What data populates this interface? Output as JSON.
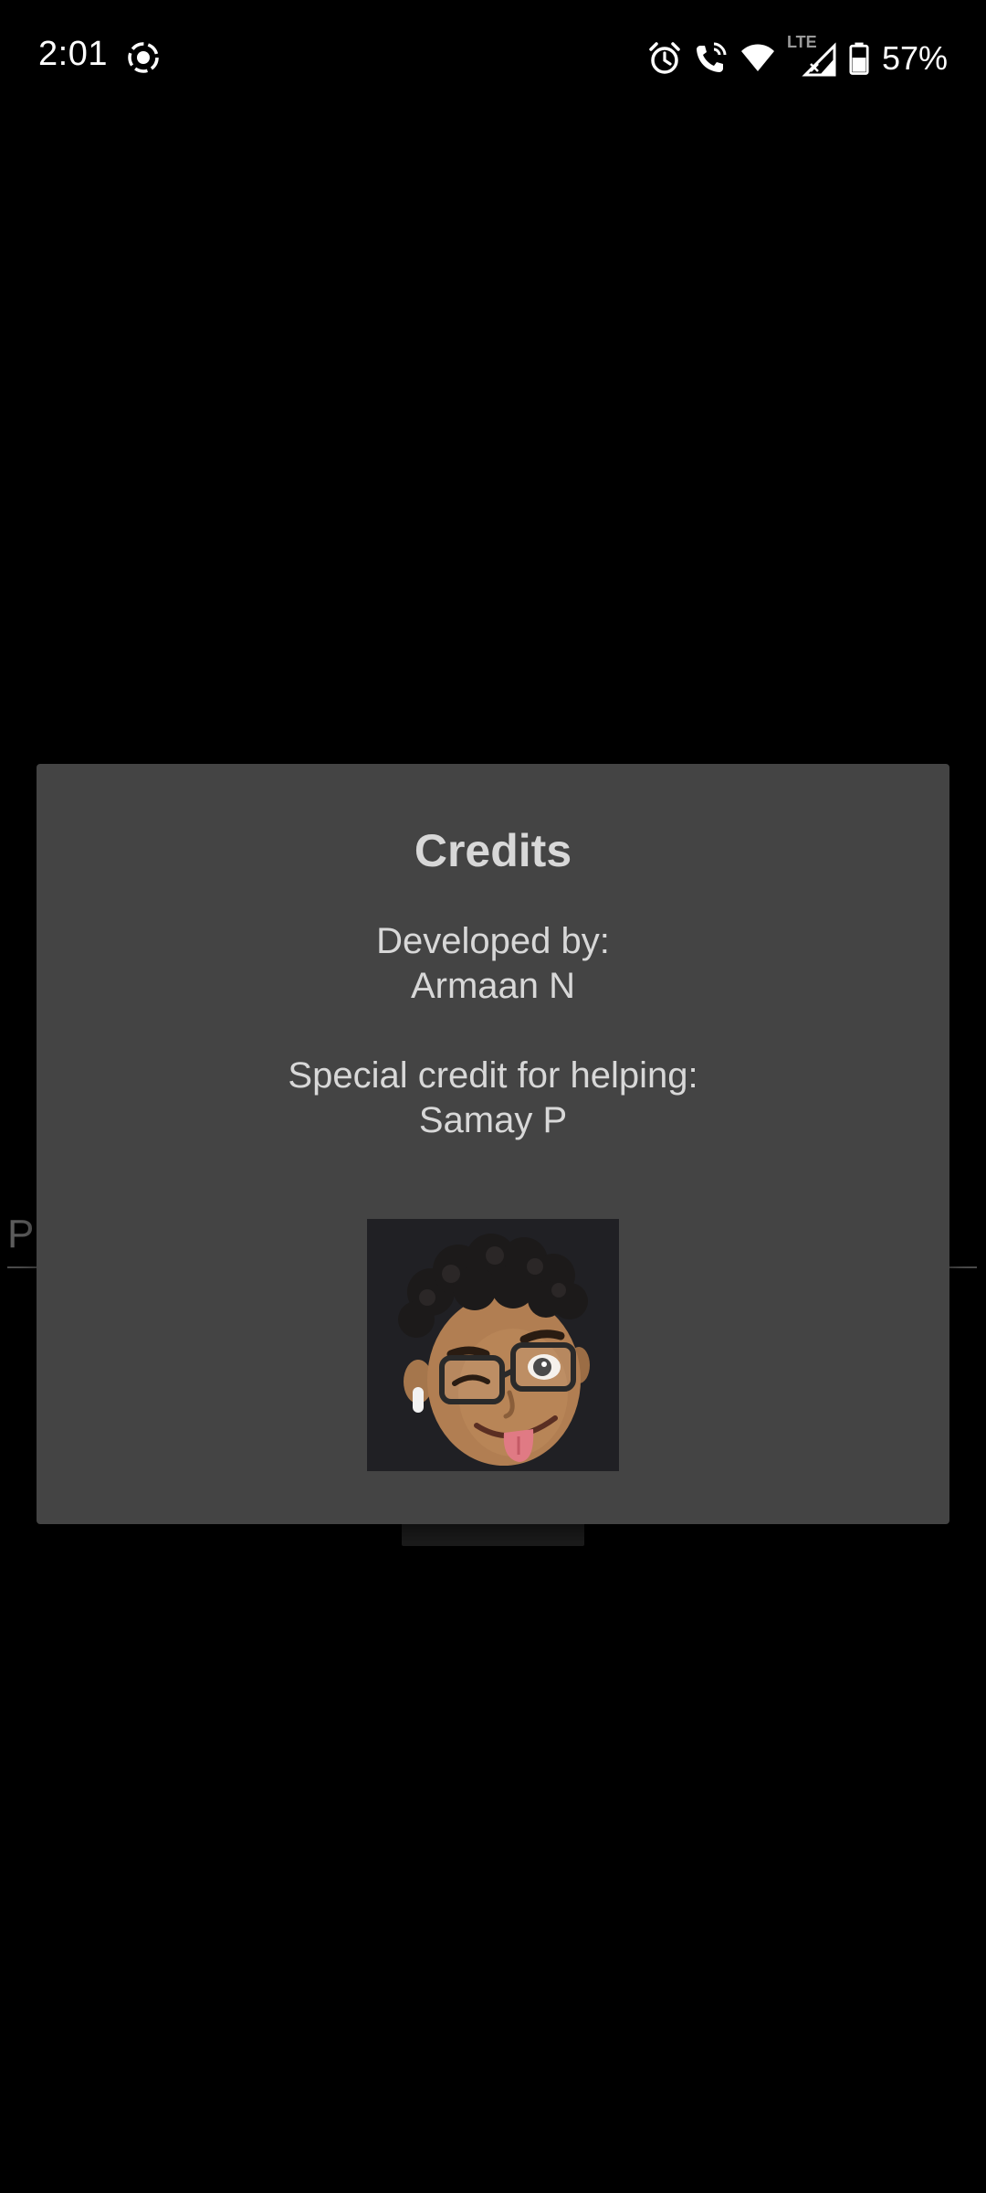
{
  "status_bar": {
    "time": "2:01",
    "network_label": "LTE",
    "battery_percent": "57%",
    "icons": [
      "screen-record-icon",
      "alarm-icon",
      "wifi-calling-icon",
      "wifi-icon",
      "cellular-signal-icon",
      "battery-icon"
    ]
  },
  "background": {
    "field_text": "P"
  },
  "dialog": {
    "title": "Credits",
    "lines": {
      "developed_label": "Developed by:",
      "developer_name": "Armaan N",
      "special_label": "Special credit for helping:",
      "helper_name": "Samay P"
    },
    "avatar_icon": "memoji-avatar"
  },
  "colors": {
    "background": "#000000",
    "dialog_bg": "#444444",
    "dialog_text": "#d8d8d8",
    "avatar_bg": "#202024"
  }
}
